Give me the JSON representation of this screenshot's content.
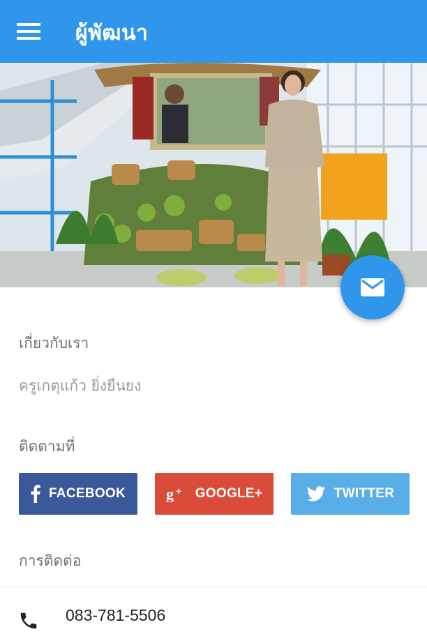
{
  "appbar": {
    "title": "ผู้พัฒนา",
    "menu_icon": "hamburger-menu-icon",
    "color": "#2f96ec"
  },
  "hero": {
    "image": "photo of a woman in uniform standing beside a vegetable display with a portrait"
  },
  "fab": {
    "icon": "mail-icon"
  },
  "about": {
    "label": "เกี่ยวกับเรา",
    "text": "ครูเกตุแก้ว ยิ่งยืนยง"
  },
  "follow": {
    "label": "ติดตามที่",
    "buttons": [
      {
        "label": "FACEBOOK",
        "icon": "facebook-icon",
        "color": "#3a599a"
      },
      {
        "label": "GOOGLE+",
        "icon": "google-plus-icon",
        "color": "#db4b39"
      },
      {
        "label": "TWITTER",
        "icon": "twitter-icon",
        "color": "#5aaee8"
      }
    ]
  },
  "contact": {
    "label": "การติดต่อ",
    "phone": "083-781-5506",
    "phone_icon": "phone-icon"
  }
}
